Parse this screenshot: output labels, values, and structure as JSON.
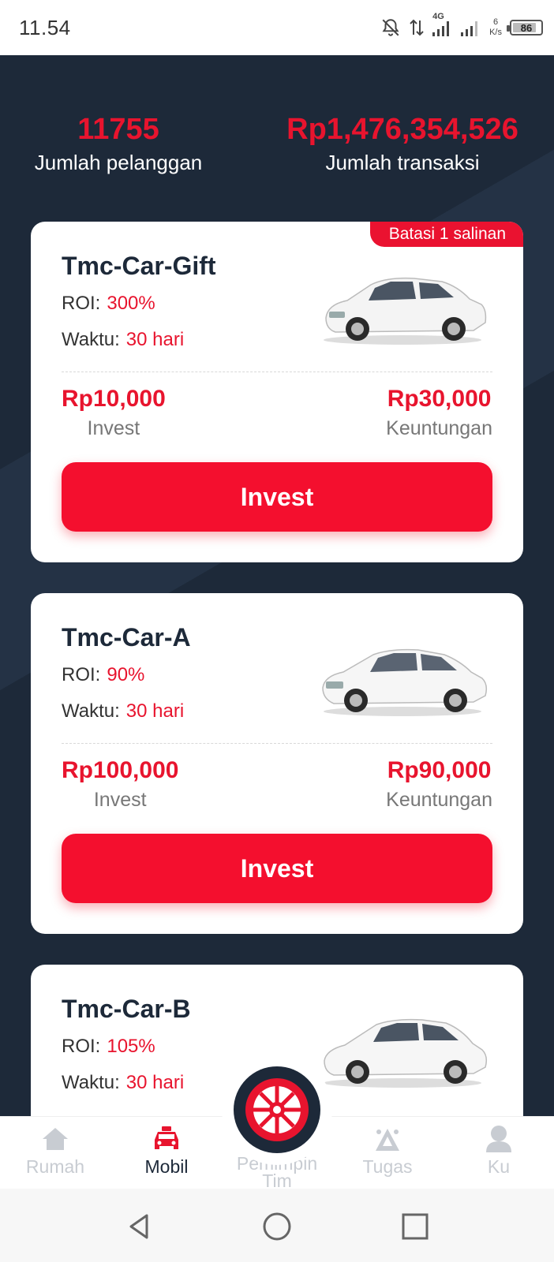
{
  "status_bar": {
    "time": "11.54",
    "network": "4G",
    "net_speed_value": "6",
    "net_speed_unit": "K/s",
    "battery": "86",
    "battery_level": 0.86
  },
  "stats": [
    {
      "value": "11755",
      "label": "Jumlah pelanggan"
    },
    {
      "value": "Rp1,476,354,526",
      "label": "Jumlah transaksi"
    }
  ],
  "cards": [
    {
      "ribbon": "Batasi 1 salinan",
      "title": "Tmc-Car-Gift",
      "roi_label": "ROI:",
      "roi_value": "300%",
      "time_label": "Waktu:",
      "time_value": "30 hari",
      "invest_value": "Rp10,000",
      "invest_label": "Invest",
      "profit_value": "Rp30,000",
      "profit_label": "Keuntungan",
      "button_label": "Invest"
    },
    {
      "title": "Tmc-Car-A",
      "roi_label": "ROI:",
      "roi_value": "90%",
      "time_label": "Waktu:",
      "time_value": "30 hari",
      "invest_value": "Rp100,000",
      "invest_label": "Invest",
      "profit_value": "Rp90,000",
      "profit_label": "Keuntungan",
      "button_label": "Invest"
    },
    {
      "title": "Tmc-Car-B",
      "roi_label": "ROI:",
      "roi_value": "105%",
      "time_label": "Waktu:",
      "time_value": "30 hari"
    }
  ],
  "bottom_nav": {
    "items": [
      {
        "label": "Rumah",
        "icon": "home-icon",
        "active": false
      },
      {
        "label": "Mobil",
        "icon": "car-icon",
        "active": true
      },
      {
        "label": "Pemimpin Tim",
        "icon": "wheel-icon",
        "active": false
      },
      {
        "label": "Tugas",
        "icon": "tasks-icon",
        "active": false
      },
      {
        "label": "Ku",
        "icon": "user-icon",
        "active": false
      }
    ]
  },
  "colors": {
    "accent": "#e8142e",
    "dark_bg": "#1d2939",
    "card_bg": "#ffffff",
    "inactive_nav": "#c8ccd2"
  }
}
